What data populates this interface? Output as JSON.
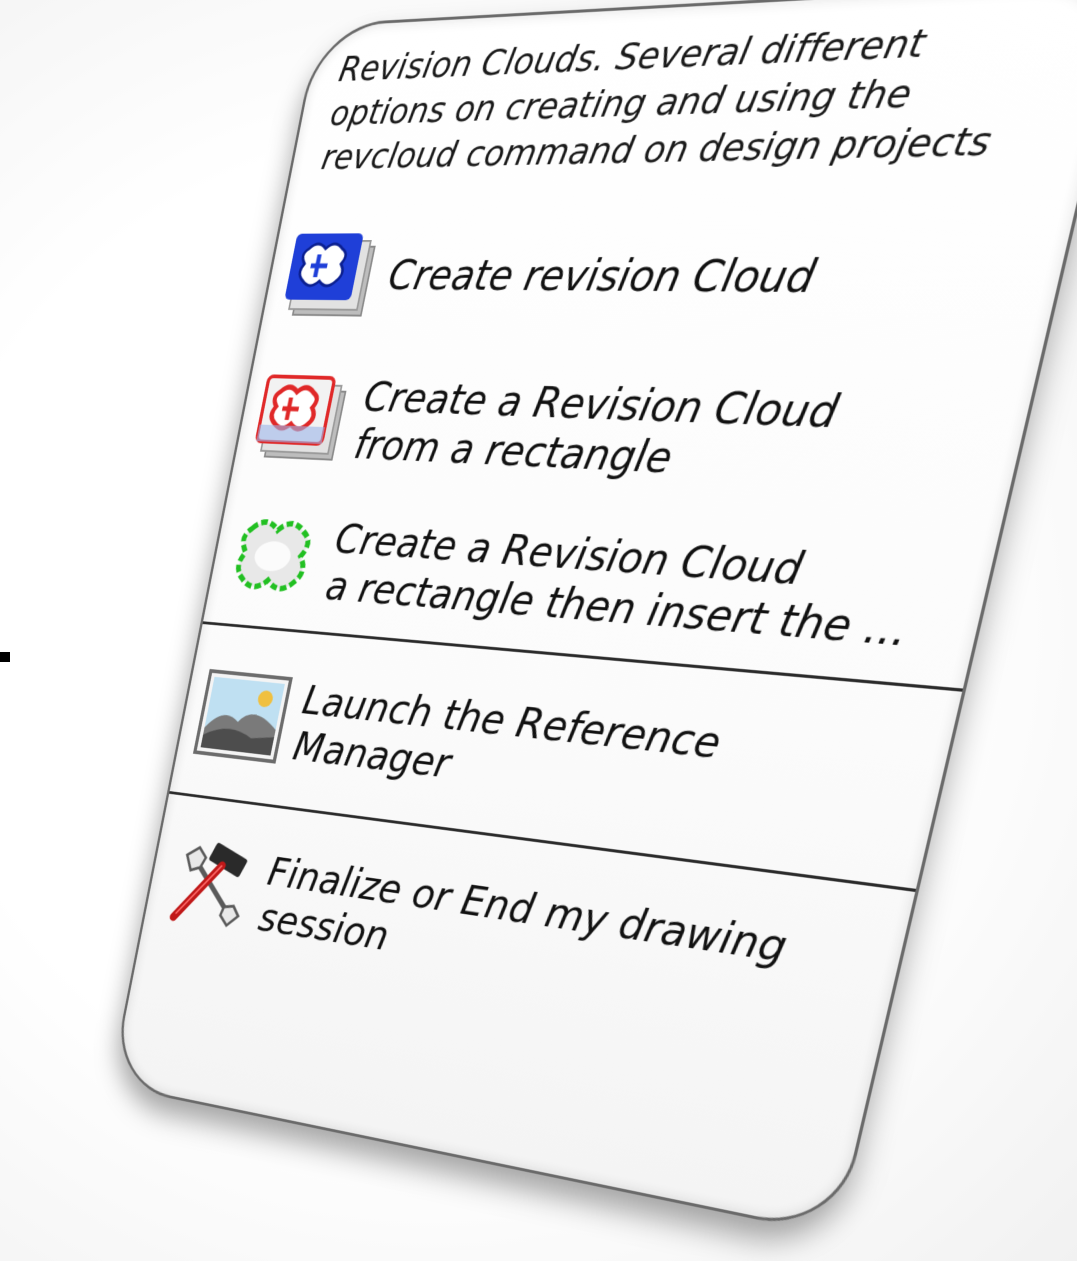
{
  "menu": {
    "description": "Revision Clouds.  Several different options on creating and using the revcloud command on design projects",
    "items": [
      {
        "line1": "Create revision Cloud",
        "line2": "",
        "icon": "revision-cloud-blue-icon",
        "accent": "#1f3fd8"
      },
      {
        "line1": "Create a Revision Cloud",
        "line2": "from a rectangle",
        "icon": "revision-cloud-red-icon",
        "accent": "#e02828"
      },
      {
        "line1": "Create a Revision Cloud",
        "line2": "a rectangle then insert the ...",
        "icon": "revision-cloud-green-icon",
        "accent": "#22c022"
      },
      {
        "line1": "Launch the Reference",
        "line2": "Manager",
        "icon": "image-landscape-icon",
        "accent": "#f0c040"
      },
      {
        "line1": "Finalize or End my drawing",
        "line2": "session",
        "icon": "hammer-wrench-icon",
        "accent": "#d01818"
      }
    ]
  }
}
